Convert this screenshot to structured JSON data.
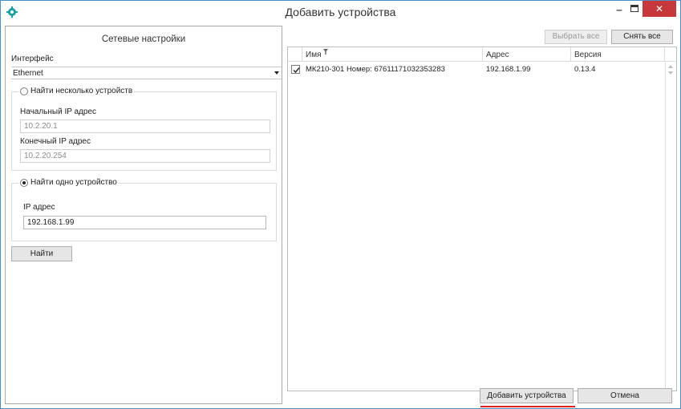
{
  "window": {
    "title": "Добавить устройства",
    "minimize_glyph": "‒",
    "close_glyph": "✕"
  },
  "network": {
    "panel_title": "Сетевые настройки",
    "interface_label": "Интерфейс",
    "interface_value": "Ethernet",
    "multi": {
      "legend": "Найти несколько устройств",
      "selected": false,
      "start_ip_label": "Начальный IP адрес",
      "start_ip_value": "10.2.20.1",
      "end_ip_label": "Конечный IP адрес",
      "end_ip_value": "10.2.20.254"
    },
    "single": {
      "legend": "Найти одно устройство",
      "selected": true,
      "ip_label": "IP адрес",
      "ip_value": "192.168.1.99"
    },
    "find_button": "Найти"
  },
  "toolbar": {
    "select_all": "Выбрать все",
    "deselect_all": "Снять все"
  },
  "table": {
    "columns": [
      "Имя",
      "Адрес",
      "Версия"
    ],
    "rows": [
      {
        "checked": true,
        "name": "МК210-301 Номер: 67611171032353283",
        "address": "192.168.1.99",
        "version": "0.13.4"
      }
    ]
  },
  "footer": {
    "add_button": "Добавить устройства",
    "cancel_button": "Отмена"
  },
  "colors": {
    "accent": "#4a90c8",
    "close": "#c7383a",
    "highlight_underline": "#e0201e"
  },
  "icons": {
    "app": "gear-icon",
    "filter": "filter-icon",
    "dropdown": "chevron-down-icon",
    "check": "checkmark-icon"
  }
}
